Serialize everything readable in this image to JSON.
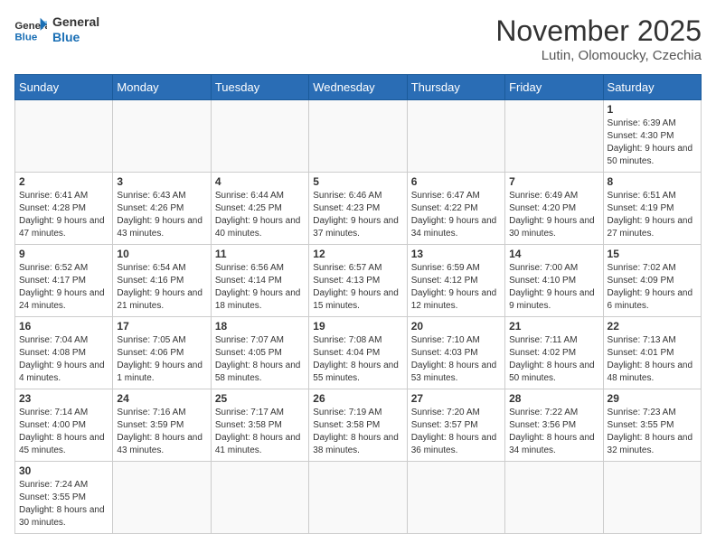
{
  "logo": {
    "general": "General",
    "blue": "Blue"
  },
  "header": {
    "title": "November 2025",
    "subtitle": "Lutin, Olomoucky, Czechia"
  },
  "weekdays": [
    "Sunday",
    "Monday",
    "Tuesday",
    "Wednesday",
    "Thursday",
    "Friday",
    "Saturday"
  ],
  "weeks": [
    [
      {
        "day": "",
        "info": ""
      },
      {
        "day": "",
        "info": ""
      },
      {
        "day": "",
        "info": ""
      },
      {
        "day": "",
        "info": ""
      },
      {
        "day": "",
        "info": ""
      },
      {
        "day": "",
        "info": ""
      },
      {
        "day": "1",
        "info": "Sunrise: 6:39 AM\nSunset: 4:30 PM\nDaylight: 9 hours and 50 minutes."
      }
    ],
    [
      {
        "day": "2",
        "info": "Sunrise: 6:41 AM\nSunset: 4:28 PM\nDaylight: 9 hours and 47 minutes."
      },
      {
        "day": "3",
        "info": "Sunrise: 6:43 AM\nSunset: 4:26 PM\nDaylight: 9 hours and 43 minutes."
      },
      {
        "day": "4",
        "info": "Sunrise: 6:44 AM\nSunset: 4:25 PM\nDaylight: 9 hours and 40 minutes."
      },
      {
        "day": "5",
        "info": "Sunrise: 6:46 AM\nSunset: 4:23 PM\nDaylight: 9 hours and 37 minutes."
      },
      {
        "day": "6",
        "info": "Sunrise: 6:47 AM\nSunset: 4:22 PM\nDaylight: 9 hours and 34 minutes."
      },
      {
        "day": "7",
        "info": "Sunrise: 6:49 AM\nSunset: 4:20 PM\nDaylight: 9 hours and 30 minutes."
      },
      {
        "day": "8",
        "info": "Sunrise: 6:51 AM\nSunset: 4:19 PM\nDaylight: 9 hours and 27 minutes."
      }
    ],
    [
      {
        "day": "9",
        "info": "Sunrise: 6:52 AM\nSunset: 4:17 PM\nDaylight: 9 hours and 24 minutes."
      },
      {
        "day": "10",
        "info": "Sunrise: 6:54 AM\nSunset: 4:16 PM\nDaylight: 9 hours and 21 minutes."
      },
      {
        "day": "11",
        "info": "Sunrise: 6:56 AM\nSunset: 4:14 PM\nDaylight: 9 hours and 18 minutes."
      },
      {
        "day": "12",
        "info": "Sunrise: 6:57 AM\nSunset: 4:13 PM\nDaylight: 9 hours and 15 minutes."
      },
      {
        "day": "13",
        "info": "Sunrise: 6:59 AM\nSunset: 4:12 PM\nDaylight: 9 hours and 12 minutes."
      },
      {
        "day": "14",
        "info": "Sunrise: 7:00 AM\nSunset: 4:10 PM\nDaylight: 9 hours and 9 minutes."
      },
      {
        "day": "15",
        "info": "Sunrise: 7:02 AM\nSunset: 4:09 PM\nDaylight: 9 hours and 6 minutes."
      }
    ],
    [
      {
        "day": "16",
        "info": "Sunrise: 7:04 AM\nSunset: 4:08 PM\nDaylight: 9 hours and 4 minutes."
      },
      {
        "day": "17",
        "info": "Sunrise: 7:05 AM\nSunset: 4:06 PM\nDaylight: 9 hours and 1 minute."
      },
      {
        "day": "18",
        "info": "Sunrise: 7:07 AM\nSunset: 4:05 PM\nDaylight: 8 hours and 58 minutes."
      },
      {
        "day": "19",
        "info": "Sunrise: 7:08 AM\nSunset: 4:04 PM\nDaylight: 8 hours and 55 minutes."
      },
      {
        "day": "20",
        "info": "Sunrise: 7:10 AM\nSunset: 4:03 PM\nDaylight: 8 hours and 53 minutes."
      },
      {
        "day": "21",
        "info": "Sunrise: 7:11 AM\nSunset: 4:02 PM\nDaylight: 8 hours and 50 minutes."
      },
      {
        "day": "22",
        "info": "Sunrise: 7:13 AM\nSunset: 4:01 PM\nDaylight: 8 hours and 48 minutes."
      }
    ],
    [
      {
        "day": "23",
        "info": "Sunrise: 7:14 AM\nSunset: 4:00 PM\nDaylight: 8 hours and 45 minutes."
      },
      {
        "day": "24",
        "info": "Sunrise: 7:16 AM\nSunset: 3:59 PM\nDaylight: 8 hours and 43 minutes."
      },
      {
        "day": "25",
        "info": "Sunrise: 7:17 AM\nSunset: 3:58 PM\nDaylight: 8 hours and 41 minutes."
      },
      {
        "day": "26",
        "info": "Sunrise: 7:19 AM\nSunset: 3:58 PM\nDaylight: 8 hours and 38 minutes."
      },
      {
        "day": "27",
        "info": "Sunrise: 7:20 AM\nSunset: 3:57 PM\nDaylight: 8 hours and 36 minutes."
      },
      {
        "day": "28",
        "info": "Sunrise: 7:22 AM\nSunset: 3:56 PM\nDaylight: 8 hours and 34 minutes."
      },
      {
        "day": "29",
        "info": "Sunrise: 7:23 AM\nSunset: 3:55 PM\nDaylight: 8 hours and 32 minutes."
      }
    ],
    [
      {
        "day": "30",
        "info": "Sunrise: 7:24 AM\nSunset: 3:55 PM\nDaylight: 8 hours and 30 minutes."
      },
      {
        "day": "",
        "info": ""
      },
      {
        "day": "",
        "info": ""
      },
      {
        "day": "",
        "info": ""
      },
      {
        "day": "",
        "info": ""
      },
      {
        "day": "",
        "info": ""
      },
      {
        "day": "",
        "info": ""
      }
    ]
  ]
}
